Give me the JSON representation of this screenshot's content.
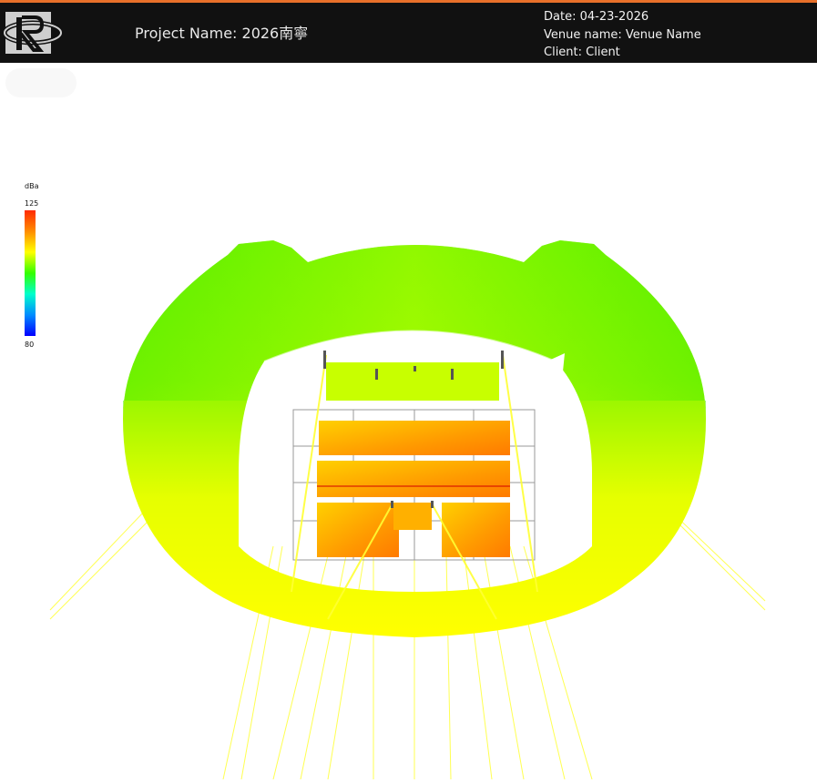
{
  "colors": {
    "accent": "#e8702a",
    "header_bg": "#111111",
    "header_text": "#f2f2f2",
    "map_high": "#ff8a00",
    "map_mid": "#ffff00",
    "map_low": "#33e600",
    "ray": "#ffff33"
  },
  "header": {
    "logo_icon": "company-logo-icon",
    "project_title": "Project Name: 2026南寧",
    "date": "Date: 04-23-2026",
    "venue": "Venue name: Venue Name",
    "client": "Client: Client"
  },
  "legend": {
    "unit": "dBa",
    "max": "125",
    "min": "80",
    "gradient": [
      "#ff2a00",
      "#ff8c00",
      "#ffff00",
      "#33ff00",
      "#00ffcc",
      "#008cff",
      "#0000ff"
    ]
  },
  "visualization": {
    "type": "SPL coverage map",
    "colormap": "rainbow"
  }
}
